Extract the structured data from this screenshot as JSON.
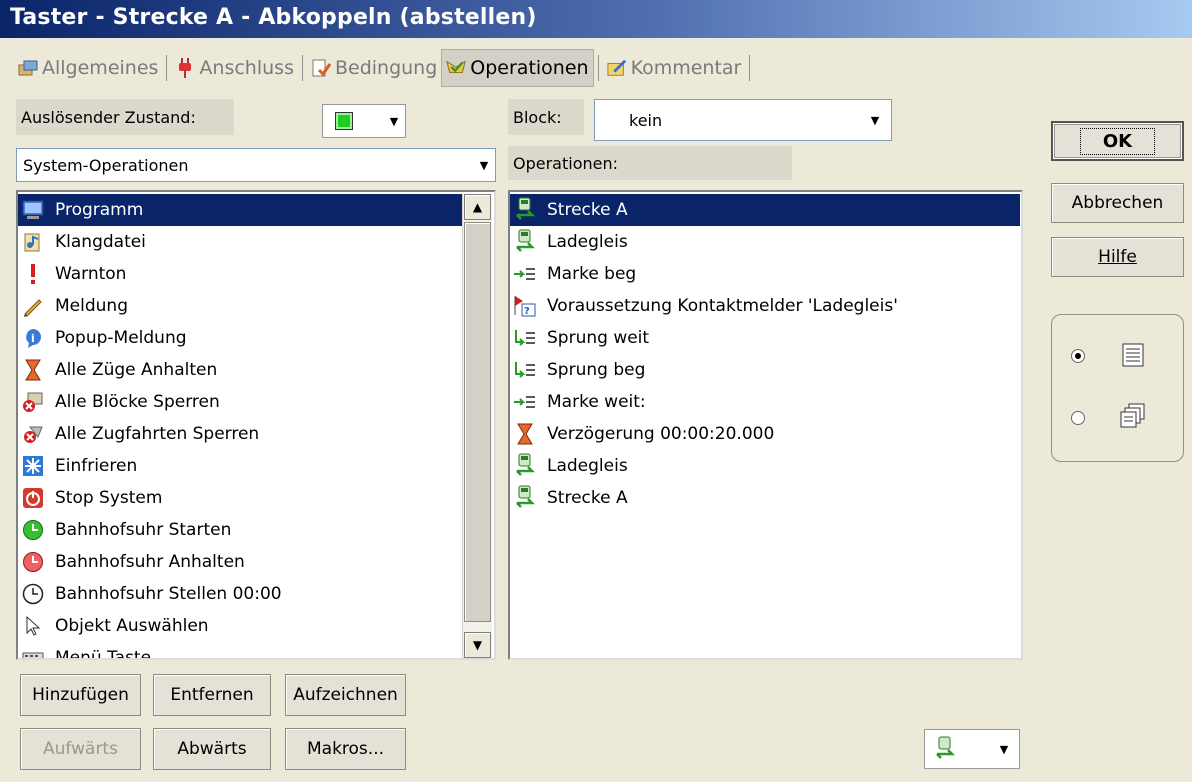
{
  "window": {
    "title": "Taster - Strecke A - Abkoppeln (abstellen)"
  },
  "tabs": [
    {
      "label": "Allgemeines",
      "icon": "general-icon",
      "active": false
    },
    {
      "label": "Anschluss",
      "icon": "plug-icon",
      "active": false
    },
    {
      "label": "Bedingung",
      "icon": "condition-icon",
      "active": false
    },
    {
      "label": "Operationen",
      "icon": "operations-icon",
      "active": true
    },
    {
      "label": "Kommentar",
      "icon": "comment-icon",
      "active": false
    }
  ],
  "trigger": {
    "label": "Auslösender Zustand:",
    "state_color": "#22cc22"
  },
  "category": {
    "value": "System-Operationen"
  },
  "block": {
    "label": "Block:",
    "value": "kein"
  },
  "operations_label": "Operationen:",
  "system_ops": [
    {
      "label": "Programm",
      "icon": "computer-icon",
      "selected": true
    },
    {
      "label": "Klangdatei",
      "icon": "sound-file-icon"
    },
    {
      "label": "Warnton",
      "icon": "exclamation-icon"
    },
    {
      "label": "Meldung",
      "icon": "pencil-icon"
    },
    {
      "label": "Popup-Meldung",
      "icon": "info-icon"
    },
    {
      "label": "Alle Züge Anhalten",
      "icon": "hourglass-icon"
    },
    {
      "label": "Alle Blöcke Sperren",
      "icon": "block-lock-icon"
    },
    {
      "label": "Alle Zugfahrten Sperren",
      "icon": "route-lock-icon"
    },
    {
      "label": "Einfrieren",
      "icon": "freeze-icon"
    },
    {
      "label": "Stop System",
      "icon": "power-icon"
    },
    {
      "label": "Bahnhofsuhr Starten",
      "icon": "clock-green-icon"
    },
    {
      "label": "Bahnhofsuhr Anhalten",
      "icon": "clock-red-icon"
    },
    {
      "label": "Bahnhofsuhr Stellen 00:00",
      "icon": "clock-icon"
    },
    {
      "label": "Objekt Auswählen",
      "icon": "cursor-icon"
    },
    {
      "label": "Menü Taste",
      "icon": "keyboard-icon"
    }
  ],
  "operations": [
    {
      "label": "Strecke A",
      "icon": "train-icon",
      "selected": true
    },
    {
      "label": "Ladegleis",
      "icon": "train-icon"
    },
    {
      "label": "Marke beg",
      "icon": "marker-icon"
    },
    {
      "label": "Voraussetzung Kontaktmelder 'Ladegleis'",
      "icon": "condition-flag-icon"
    },
    {
      "label": "Sprung weit",
      "icon": "jump-icon"
    },
    {
      "label": "Sprung beg",
      "icon": "jump-icon"
    },
    {
      "label": "Marke weit:",
      "icon": "marker-icon"
    },
    {
      "label": "Verzögerung 00:00:20.000",
      "icon": "hourglass-icon"
    },
    {
      "label": "Ladegleis",
      "icon": "train-icon"
    },
    {
      "label": "Strecke A",
      "icon": "train-icon"
    }
  ],
  "buttons": {
    "add": "Hinzufügen",
    "remove": "Entfernen",
    "record": "Aufzeichnen",
    "up": "Aufwärts",
    "down": "Abwärts",
    "macros": "Makros...",
    "ok": "OK",
    "cancel": "Abbrechen",
    "help": "Hilfe"
  },
  "view_mode": {
    "selected": "list"
  }
}
